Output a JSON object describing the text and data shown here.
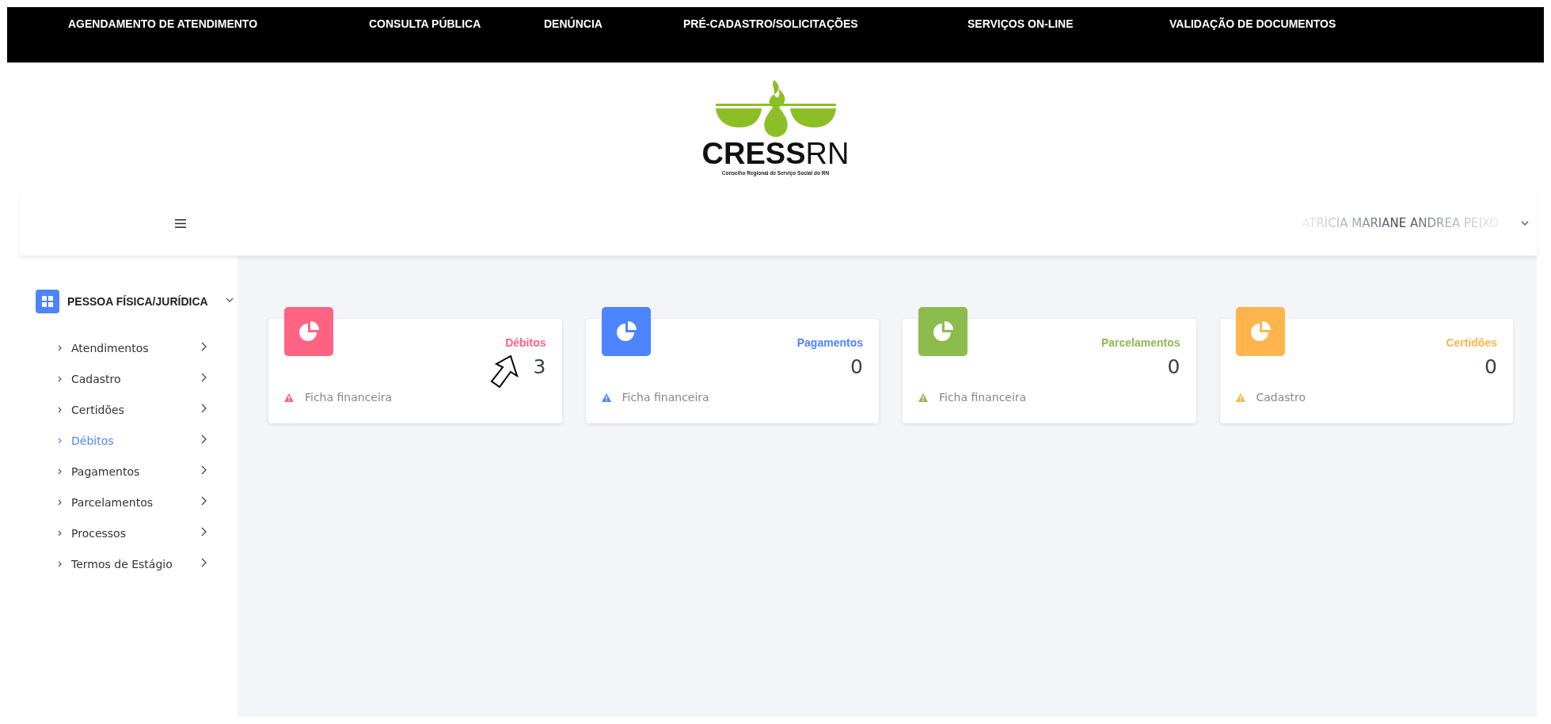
{
  "top_nav": [
    {
      "label": "AGENDAMENTO DE ATENDIMENTO"
    },
    {
      "label": "CONSULTA PÚBLICA"
    },
    {
      "label": "DENÚNCIA"
    },
    {
      "label": "PRÉ-CADASTRO/SOLICITAÇÕES"
    },
    {
      "label": "SERVIÇOS ON-LINE"
    },
    {
      "label": "VALIDAÇÃO DE DOCUMENTOS"
    }
  ],
  "logo": {
    "name": "CRESS",
    "suffix": "RN",
    "subtitle": "Conselho Regional de Serviço Social do RN"
  },
  "header": {
    "user_name": "ATRÍCIA MARIANE ANDREA PEIXO"
  },
  "sidebar": {
    "section": {
      "label": "PESSOA FÍSICA/JURÍDICA",
      "expanded": true
    },
    "items": [
      {
        "label": "Atendimentos",
        "selected": false
      },
      {
        "label": "Cadastro",
        "selected": false
      },
      {
        "label": "Certidões",
        "selected": false
      },
      {
        "label": "Débitos",
        "selected": true
      },
      {
        "label": "Pagamentos",
        "selected": false
      },
      {
        "label": "Parcelamentos",
        "selected": false
      },
      {
        "label": "Processos",
        "selected": false
      },
      {
        "label": "Termos de Estágio",
        "selected": false
      }
    ]
  },
  "cards": [
    {
      "title": "Débitos",
      "value": "3",
      "footer": "Ficha financeira",
      "color": "#fe6383",
      "pointer": true
    },
    {
      "title": "Pagamentos",
      "value": "0",
      "footer": "Ficha financeira",
      "color": "#4d84ff",
      "pointer": false
    },
    {
      "title": "Parcelamentos",
      "value": "0",
      "footer": "Ficha financeira",
      "color": "#8cbb4e",
      "pointer": false
    },
    {
      "title": "Certidões",
      "value": "0",
      "footer": "Cadastro",
      "color": "#ffb54c",
      "pointer": false
    }
  ]
}
